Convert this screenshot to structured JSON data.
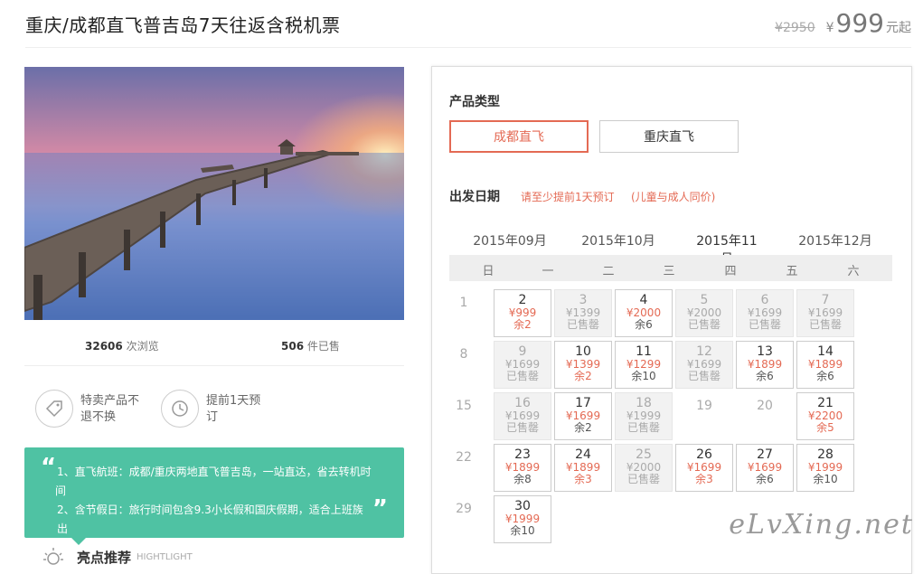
{
  "header": {
    "title": "重庆/成都直飞普吉岛7天往返含税机票",
    "old_price": "¥2950",
    "yen": "¥",
    "price": "999",
    "price_suffix": "元起"
  },
  "stats": {
    "views_number": "32606",
    "views_label": "次浏览",
    "sold_number": "506",
    "sold_label": "件已售"
  },
  "features": [
    {
      "text": "特卖产品不\n退不换",
      "icon": "tag-icon"
    },
    {
      "text": "提前1天预\n订",
      "icon": "clock-icon"
    }
  ],
  "note": {
    "line1": "1、直飞航班：成都/重庆两地直飞普吉岛，一站直达，省去转机时",
    "line1b": "间",
    "line2": "2、含节假日：旅行时间包含9.3小长假和国庆假期，适合上班族出",
    "open_quote": "“",
    "close_quote": "”"
  },
  "highlight": {
    "title": "亮点推荐",
    "english": "HIGHTLIGHT"
  },
  "product": {
    "type_label": "产品类型",
    "types": [
      "成都直飞",
      "重庆直飞"
    ],
    "active_type": 0
  },
  "departure": {
    "label": "出发日期",
    "note1": "请至少提前1天预订",
    "note2": "(儿童与成人同价)"
  },
  "months": [
    "2015年09月",
    "2015年10月",
    "2015年11月",
    "2015年12月"
  ],
  "active_month": 2,
  "weekdays": [
    "日",
    "一",
    "二",
    "三",
    "四",
    "五",
    "六"
  ],
  "calendar": [
    [
      {
        "d": "1",
        "t": "plain"
      },
      {
        "d": "2",
        "p": "¥999",
        "s": "余2",
        "t": "avail",
        "red": true
      },
      {
        "d": "3",
        "p": "¥1399",
        "s": "已售罄",
        "t": "sold"
      },
      {
        "d": "4",
        "p": "¥2000",
        "s": "余6",
        "t": "avail"
      },
      {
        "d": "5",
        "p": "¥2000",
        "s": "已售罄",
        "t": "sold"
      },
      {
        "d": "6",
        "p": "¥1699",
        "s": "已售罄",
        "t": "sold"
      },
      {
        "d": "7",
        "p": "¥1699",
        "s": "已售罄",
        "t": "sold"
      }
    ],
    [
      {
        "d": "8",
        "t": "plain"
      },
      {
        "d": "9",
        "p": "¥1699",
        "s": "已售罄",
        "t": "sold"
      },
      {
        "d": "10",
        "p": "¥1399",
        "s": "余2",
        "t": "avail",
        "red": true
      },
      {
        "d": "11",
        "p": "¥1299",
        "s": "余10",
        "t": "avail"
      },
      {
        "d": "12",
        "p": "¥1699",
        "s": "已售罄",
        "t": "sold"
      },
      {
        "d": "13",
        "p": "¥1899",
        "s": "余6",
        "t": "avail"
      },
      {
        "d": "14",
        "p": "¥1899",
        "s": "余6",
        "t": "avail"
      }
    ],
    [
      {
        "d": "15",
        "t": "plain"
      },
      {
        "d": "16",
        "p": "¥1699",
        "s": "已售罄",
        "t": "sold"
      },
      {
        "d": "17",
        "p": "¥1699",
        "s": "余2",
        "t": "avail"
      },
      {
        "d": "18",
        "p": "¥1999",
        "s": "已售罄",
        "t": "sold"
      },
      {
        "d": "19",
        "t": "plain"
      },
      {
        "d": "20",
        "t": "plain"
      },
      {
        "d": "21",
        "p": "¥2200",
        "s": "余5",
        "t": "avail",
        "red": true
      }
    ],
    [
      {
        "d": "22",
        "t": "plain"
      },
      {
        "d": "23",
        "p": "¥1899",
        "s": "余8",
        "t": "avail"
      },
      {
        "d": "24",
        "p": "¥1899",
        "s": "余3",
        "t": "avail",
        "red": true
      },
      {
        "d": "25",
        "p": "¥2000",
        "s": "已售罄",
        "t": "sold"
      },
      {
        "d": "26",
        "p": "¥1699",
        "s": "余3",
        "t": "avail",
        "red": true
      },
      {
        "d": "27",
        "p": "¥1699",
        "s": "余6",
        "t": "avail"
      },
      {
        "d": "28",
        "p": "¥1999",
        "s": "余10",
        "t": "avail"
      }
    ],
    [
      {
        "d": "29",
        "t": "plain"
      },
      {
        "d": "30",
        "p": "¥1999",
        "s": "余10",
        "t": "avail"
      }
    ]
  ],
  "watermark": "eLvXing.net",
  "colors": {
    "accent": "#e46a54",
    "note_bg": "#4fc2a3"
  }
}
